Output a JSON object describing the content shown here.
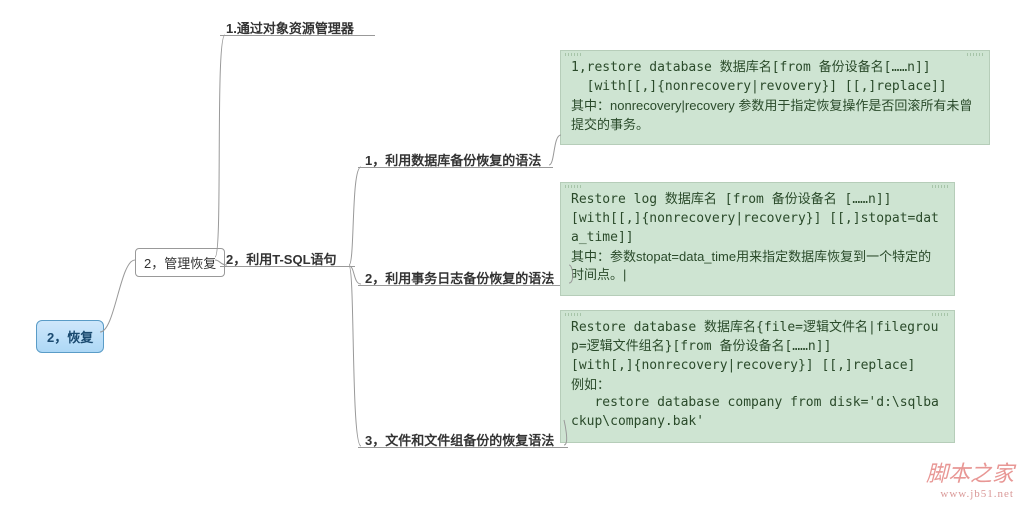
{
  "root": {
    "label": "2，恢复"
  },
  "level1": {
    "label": "2，管理恢复"
  },
  "branch1": {
    "label": "1.通过对象资源管理器"
  },
  "branch2": {
    "label": "2，利用T-SQL语句"
  },
  "tsql": {
    "item1": {
      "label": "1，利用数据库备份恢复的语法",
      "note_line1": "1,restore database 数据库名[from 备份设备名[……n]]",
      "note_line2": "  [with[[,]{nonrecovery|revovery}] [[,]replace]]",
      "note_line3": "其中：nonrecovery|recovery  参数用于指定恢复操作是否回滚所有未曾提交的事务。"
    },
    "item2": {
      "label": "2，利用事务日志备份恢复的语法",
      "note_line1": "Restore log 数据库名 [from 备份设备名 [……n]]",
      "note_line2": "[with[[,]{nonrecovery|recovery}] [[,]stopat=data_time]]",
      "note_line3": "其中：参数stopat=data_time用来指定数据库恢复到一个特定的时间点。|"
    },
    "item3": {
      "label": "3，文件和文件组备份的恢复语法",
      "note_line1": "Restore database 数据库名{file=逻辑文件名|filegroup=逻辑文件组名}[from 备份设备名[……n]]",
      "note_line2": "[with[,]{nonrecovery|recovery}] [[,]replace]",
      "note_line3": "例如：",
      "note_line4": "   restore database company from disk='d:\\sqlbackup\\company.bak'"
    }
  },
  "watermark": {
    "line1": "脚本之家",
    "line2": "www.jb51.net"
  }
}
